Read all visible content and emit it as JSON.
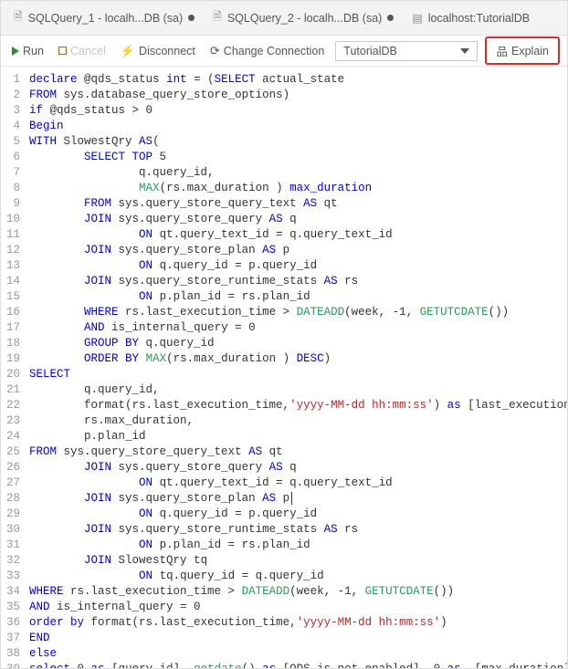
{
  "tabs": [
    {
      "label": "SQLQuery_1 - localh...DB (sa)",
      "dirty": true
    },
    {
      "label": "SQLQuery_2 - localh...DB (sa)",
      "dirty": true
    },
    {
      "label": "localhost:TutorialDB",
      "dirty": false
    }
  ],
  "toolbar": {
    "run": "Run",
    "cancel": "Cancel",
    "disconnect": "Disconnect",
    "change_connection": "Change Connection",
    "db_selected": "TutorialDB",
    "explain": "Explain"
  },
  "code": {
    "line_count": 39,
    "lines": [
      {
        "indent": 0,
        "tokens": [
          {
            "t": "declare",
            "c": "kw"
          },
          {
            "t": " @qds_status "
          },
          {
            "t": "int",
            "c": "kw"
          },
          {
            "t": " = ("
          },
          {
            "t": "SELECT",
            "c": "kw"
          },
          {
            "t": " actual_state"
          }
        ]
      },
      {
        "indent": 0,
        "tokens": [
          {
            "t": "FROM",
            "c": "kw"
          },
          {
            "t": " sys.database_query_store_options)"
          }
        ]
      },
      {
        "indent": 0,
        "tokens": [
          {
            "t": "if",
            "c": "kw"
          },
          {
            "t": " @qds_status > 0"
          }
        ]
      },
      {
        "indent": 0,
        "tokens": [
          {
            "t": "Begin",
            "c": "kw"
          }
        ]
      },
      {
        "indent": 0,
        "tokens": [
          {
            "t": "WITH",
            "c": "kw"
          },
          {
            "t": " SlowestQry "
          },
          {
            "t": "AS",
            "c": "kw"
          },
          {
            "t": "("
          }
        ]
      },
      {
        "indent": 2,
        "tokens": [
          {
            "t": "SELECT TOP",
            "c": "kw"
          },
          {
            "t": " 5"
          }
        ]
      },
      {
        "indent": 4,
        "tokens": [
          {
            "t": "q.query_id,"
          }
        ]
      },
      {
        "indent": 4,
        "tokens": [
          {
            "t": "MAX",
            "c": "fn"
          },
          {
            "t": "(rs.max_duration ) "
          },
          {
            "t": "max_duration",
            "c": "kw"
          }
        ]
      },
      {
        "indent": 2,
        "tokens": [
          {
            "t": "FROM",
            "c": "kw"
          },
          {
            "t": " sys.query_store_query_text "
          },
          {
            "t": "AS",
            "c": "kw"
          },
          {
            "t": " qt"
          }
        ]
      },
      {
        "indent": 2,
        "tokens": [
          {
            "t": "JOIN",
            "c": "kw"
          },
          {
            "t": " sys.query_store_query "
          },
          {
            "t": "AS",
            "c": "kw"
          },
          {
            "t": " q"
          }
        ]
      },
      {
        "indent": 4,
        "tokens": [
          {
            "t": "ON",
            "c": "kw"
          },
          {
            "t": " qt.query_text_id = q.query_text_id"
          }
        ]
      },
      {
        "indent": 2,
        "tokens": [
          {
            "t": "JOIN",
            "c": "kw"
          },
          {
            "t": " sys.query_store_plan "
          },
          {
            "t": "AS",
            "c": "kw"
          },
          {
            "t": " p"
          }
        ]
      },
      {
        "indent": 4,
        "tokens": [
          {
            "t": "ON",
            "c": "kw"
          },
          {
            "t": " q.query_id = p.query_id"
          }
        ]
      },
      {
        "indent": 2,
        "tokens": [
          {
            "t": "JOIN",
            "c": "kw"
          },
          {
            "t": " sys.query_store_runtime_stats "
          },
          {
            "t": "AS",
            "c": "kw"
          },
          {
            "t": " rs"
          }
        ]
      },
      {
        "indent": 4,
        "tokens": [
          {
            "t": "ON",
            "c": "kw"
          },
          {
            "t": " p.plan_id = rs.plan_id"
          }
        ]
      },
      {
        "indent": 2,
        "tokens": [
          {
            "t": "WHERE",
            "c": "kw"
          },
          {
            "t": " rs.last_execution_time > "
          },
          {
            "t": "DATEADD",
            "c": "fn"
          },
          {
            "t": "(week, -1, "
          },
          {
            "t": "GETUTCDATE",
            "c": "fn"
          },
          {
            "t": "())"
          }
        ]
      },
      {
        "indent": 2,
        "tokens": [
          {
            "t": "AND",
            "c": "kw"
          },
          {
            "t": " is_internal_query = 0"
          }
        ]
      },
      {
        "indent": 2,
        "tokens": [
          {
            "t": "GROUP BY",
            "c": "kw"
          },
          {
            "t": " q.query_id"
          }
        ]
      },
      {
        "indent": 2,
        "tokens": [
          {
            "t": "ORDER BY",
            "c": "kw"
          },
          {
            "t": " "
          },
          {
            "t": "MAX",
            "c": "fn"
          },
          {
            "t": "(rs.max_duration ) "
          },
          {
            "t": "DESC",
            "c": "kw"
          },
          {
            "t": ")"
          }
        ]
      },
      {
        "indent": 0,
        "tokens": [
          {
            "t": "SELECT",
            "c": "kw"
          }
        ]
      },
      {
        "indent": 2,
        "tokens": [
          {
            "t": "q.query_id,"
          }
        ]
      },
      {
        "indent": 2,
        "tokens": [
          {
            "t": "format(rs.last_execution_time,"
          },
          {
            "t": "'yyyy-MM-dd hh:mm:ss'",
            "c": "str"
          },
          {
            "t": ") "
          },
          {
            "t": "as",
            "c": "kw"
          },
          {
            "t": " [last_execution_time],"
          }
        ]
      },
      {
        "indent": 2,
        "tokens": [
          {
            "t": "rs.max_duration,"
          }
        ]
      },
      {
        "indent": 2,
        "tokens": [
          {
            "t": "p.plan_id"
          }
        ]
      },
      {
        "indent": 0,
        "tokens": [
          {
            "t": "FROM",
            "c": "kw"
          },
          {
            "t": " sys.query_store_query_text "
          },
          {
            "t": "AS",
            "c": "kw"
          },
          {
            "t": " qt"
          }
        ]
      },
      {
        "indent": 2,
        "tokens": [
          {
            "t": "JOIN",
            "c": "kw"
          },
          {
            "t": " sys.query_store_query "
          },
          {
            "t": "AS",
            "c": "kw"
          },
          {
            "t": " q"
          }
        ]
      },
      {
        "indent": 4,
        "tokens": [
          {
            "t": "ON",
            "c": "kw"
          },
          {
            "t": " qt.query_text_id = q.query_text_id"
          }
        ]
      },
      {
        "indent": 2,
        "tokens": [
          {
            "t": "JOIN",
            "c": "kw"
          },
          {
            "t": " sys.query_store_plan "
          },
          {
            "t": "AS",
            "c": "kw"
          },
          {
            "t": " p"
          }
        ],
        "cursor": true
      },
      {
        "indent": 4,
        "tokens": [
          {
            "t": "ON",
            "c": "kw"
          },
          {
            "t": " q.query_id = p.query_id"
          }
        ]
      },
      {
        "indent": 2,
        "tokens": [
          {
            "t": "JOIN",
            "c": "kw"
          },
          {
            "t": " sys.query_store_runtime_stats "
          },
          {
            "t": "AS",
            "c": "kw"
          },
          {
            "t": " rs"
          }
        ]
      },
      {
        "indent": 4,
        "tokens": [
          {
            "t": "ON",
            "c": "kw"
          },
          {
            "t": " p.plan_id = rs.plan_id"
          }
        ]
      },
      {
        "indent": 2,
        "tokens": [
          {
            "t": "JOIN",
            "c": "kw"
          },
          {
            "t": " SlowestQry tq"
          }
        ]
      },
      {
        "indent": 4,
        "tokens": [
          {
            "t": "ON",
            "c": "kw"
          },
          {
            "t": " tq.query_id = q.query_id"
          }
        ]
      },
      {
        "indent": 0,
        "tokens": [
          {
            "t": "WHERE",
            "c": "kw"
          },
          {
            "t": " rs.last_execution_time > "
          },
          {
            "t": "DATEADD",
            "c": "fn"
          },
          {
            "t": "(week, -1, "
          },
          {
            "t": "GETUTCDATE",
            "c": "fn"
          },
          {
            "t": "())"
          }
        ]
      },
      {
        "indent": 0,
        "tokens": [
          {
            "t": "AND",
            "c": "kw"
          },
          {
            "t": " is_internal_query = 0"
          }
        ]
      },
      {
        "indent": 0,
        "tokens": [
          {
            "t": "order by",
            "c": "kw"
          },
          {
            "t": " format(rs.last_execution_time,"
          },
          {
            "t": "'yyyy-MM-dd hh:mm:ss'",
            "c": "str"
          },
          {
            "t": ")"
          }
        ]
      },
      {
        "indent": 0,
        "tokens": [
          {
            "t": "END",
            "c": "kw"
          }
        ]
      },
      {
        "indent": 0,
        "tokens": [
          {
            "t": "else",
            "c": "kw"
          }
        ]
      },
      {
        "indent": 0,
        "tokens": [
          {
            "t": "select",
            "c": "kw"
          },
          {
            "t": " 0 "
          },
          {
            "t": "as",
            "c": "kw"
          },
          {
            "t": " [query_id], "
          },
          {
            "t": "getdate",
            "c": "fn"
          },
          {
            "t": "() "
          },
          {
            "t": "as",
            "c": "kw"
          },
          {
            "t": " [QDS is not enabled], 0 "
          },
          {
            "t": "as",
            "c": "kw"
          },
          {
            "t": "  [max_duration]"
          }
        ]
      }
    ]
  }
}
